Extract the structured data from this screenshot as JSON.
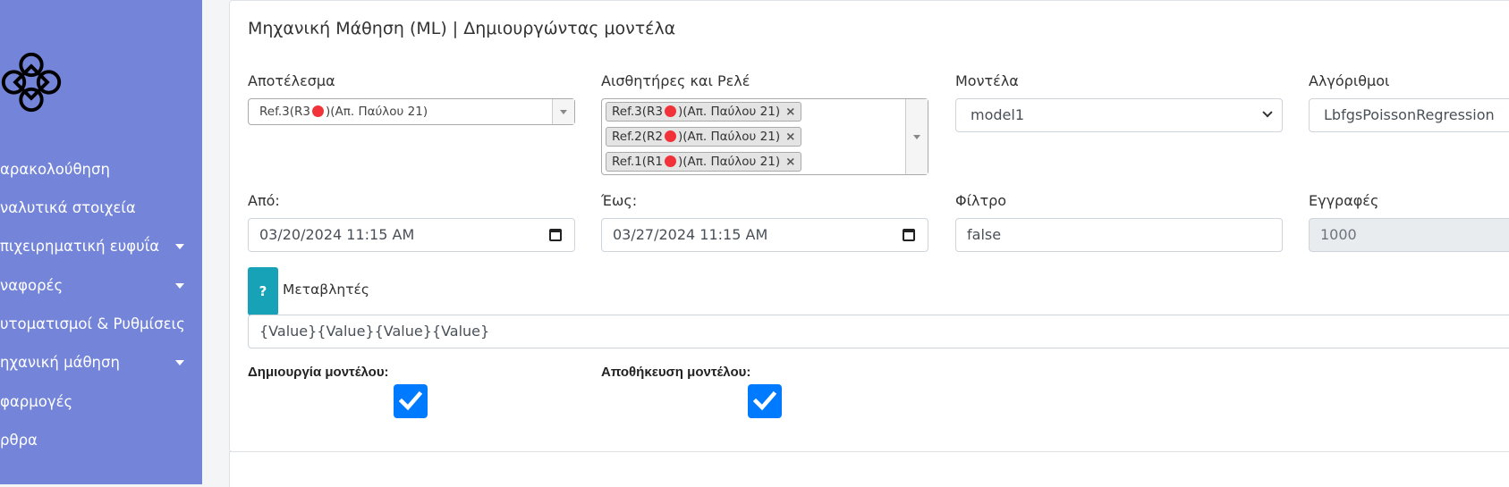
{
  "sidebar": {
    "items": [
      {
        "label": "αρακολούθηση",
        "caret": false
      },
      {
        "label": "ναλυτικά στοιχεία",
        "caret": false
      },
      {
        "label": "πιχειρηματική ευφυΐα",
        "caret": true
      },
      {
        "label": "ναφορές",
        "caret": true
      },
      {
        "label": "υτοματισμοί & Ρυθμίσεις",
        "caret": false
      },
      {
        "label": "ηχανική μάθηση",
        "caret": true
      },
      {
        "label": "φαρμογές",
        "caret": false
      },
      {
        "label": "ρθρα",
        "caret": false
      }
    ],
    "logo_icon": "knot-logo-icon"
  },
  "main": {
    "title": "Μηχανική Μάθηση (ML) | Δημιουργώντας μοντέλα",
    "result": {
      "label": "Αποτέλεσμα",
      "value_prefix": "Ref.3(R3",
      "value_suffix": ")(Απ. Παύλου 21)"
    },
    "sensors": {
      "label": "Αισθητήρες και Ρελέ",
      "tags": [
        {
          "prefix": "Ref.3(R3",
          "suffix": ")(Απ. Παύλου 21)"
        },
        {
          "prefix": "Ref.2(R2",
          "suffix": ")(Απ. Παύλου 21)"
        },
        {
          "prefix": "Ref.1(R1",
          "suffix": ")(Απ. Παύλου 21)"
        }
      ],
      "remove_symbol": "×"
    },
    "models": {
      "label": "Μοντέλα",
      "value": "model1"
    },
    "algorithms": {
      "label": "Αλγόριθμοι",
      "value": "LbfgsPoissonRegression"
    },
    "from": {
      "label": "Από:",
      "value": "03/20/2024 11:15 AM"
    },
    "to": {
      "label": "Έως:",
      "value": "03/27/2024 11:15 AM"
    },
    "filter": {
      "label": "Φίλτρο",
      "value": "false"
    },
    "records": {
      "label": "Εγγραφές",
      "value": "1000"
    },
    "help_button": "?",
    "variables": {
      "label": "Μεταβλητές",
      "value": "{Value}{Value}{Value}{Value}"
    },
    "create_model": {
      "label": "Δημιουργία μοντέλου:",
      "checked": true
    },
    "save_model": {
      "label": "Αποθήκευση μοντέλου:",
      "checked": true
    }
  },
  "colors": {
    "sidebar": "#7485d9",
    "help": "#17a2b8",
    "checkbox": "#007bff",
    "status_dot": "#f2323a"
  }
}
